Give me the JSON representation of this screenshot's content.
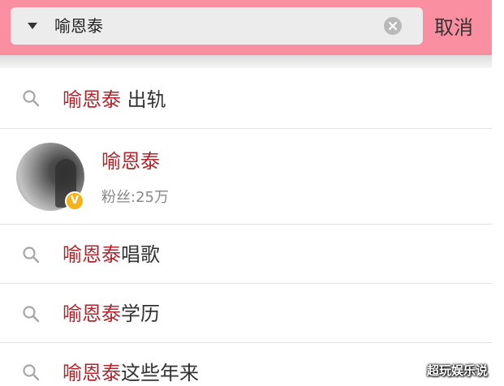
{
  "search": {
    "query": "喻恩泰",
    "cancel_label": "取消"
  },
  "suggestions": [
    {
      "highlight": "喻恩泰",
      "rest": " 出轨"
    },
    {
      "highlight": "喻恩泰",
      "rest": "唱歌"
    },
    {
      "highlight": "喻恩泰",
      "rest": "学历"
    },
    {
      "highlight": "喻恩泰",
      "rest": "这些年来"
    }
  ],
  "user_result": {
    "name": "喻恩泰",
    "fans": "粉丝:25万",
    "badge": "V"
  },
  "watermark": "超玩娱乐说",
  "colors": {
    "topbar": "#f98fa0",
    "highlight": "#b3252c",
    "verified_badge": "#f5b21b"
  },
  "icons": [
    "dropdown-caret-icon",
    "clear-icon",
    "search-icon",
    "verified-icon"
  ]
}
